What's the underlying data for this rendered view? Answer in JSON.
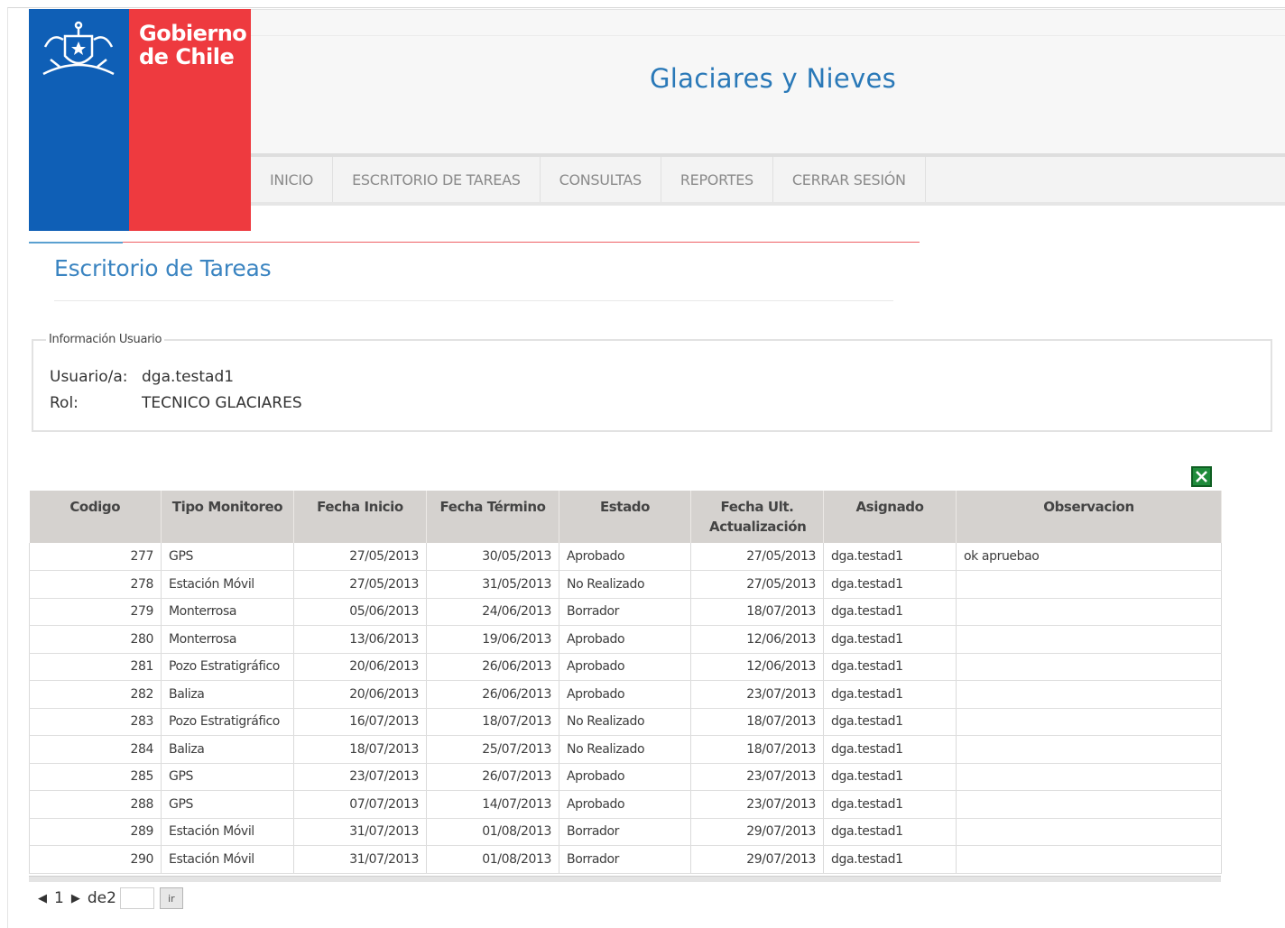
{
  "logo": {
    "line1": "Gobierno",
    "line2": "de Chile"
  },
  "header": {
    "title": "Glaciares y Nieves"
  },
  "nav": [
    "INICIO",
    "ESCRITORIO DE TAREAS",
    "CONSULTAS",
    "REPORTES",
    "CERRAR SESIÓN"
  ],
  "page": {
    "title": "Escritorio de Tareas"
  },
  "user_info": {
    "legend": "Información Usuario",
    "user_label": "Usuario/a:",
    "user_value": "dga.testad1",
    "role_label": "Rol:",
    "role_value": "TECNICO GLACIARES"
  },
  "table": {
    "headers": [
      "Codigo",
      "Tipo Monitoreo",
      "Fecha Inicio",
      "Fecha Término",
      "Estado",
      "Fecha Ult. Actualización",
      "Asignado",
      "Observacion"
    ],
    "rows": [
      [
        "277",
        "GPS",
        "27/05/2013",
        "30/05/2013",
        "Aprobado",
        "27/05/2013",
        "dga.testad1",
        "ok apruebao"
      ],
      [
        "278",
        "Estación Móvil",
        "27/05/2013",
        "31/05/2013",
        "No Realizado",
        "27/05/2013",
        "dga.testad1",
        ""
      ],
      [
        "279",
        "Monterrosa",
        "05/06/2013",
        "24/06/2013",
        "Borrador",
        "18/07/2013",
        "dga.testad1",
        ""
      ],
      [
        "280",
        "Monterrosa",
        "13/06/2013",
        "19/06/2013",
        "Aprobado",
        "12/06/2013",
        "dga.testad1",
        ""
      ],
      [
        "281",
        "Pozo Estratigráfico",
        "20/06/2013",
        "26/06/2013",
        "Aprobado",
        "12/06/2013",
        "dga.testad1",
        ""
      ],
      [
        "282",
        "Baliza",
        "20/06/2013",
        "26/06/2013",
        "Aprobado",
        "23/07/2013",
        "dga.testad1",
        ""
      ],
      [
        "283",
        "Pozo Estratigráfico",
        "16/07/2013",
        "18/07/2013",
        "No Realizado",
        "18/07/2013",
        "dga.testad1",
        ""
      ],
      [
        "284",
        "Baliza",
        "18/07/2013",
        "25/07/2013",
        "No Realizado",
        "18/07/2013",
        "dga.testad1",
        ""
      ],
      [
        "285",
        "GPS",
        "23/07/2013",
        "26/07/2013",
        "Aprobado",
        "23/07/2013",
        "dga.testad1",
        ""
      ],
      [
        "288",
        "GPS",
        "07/07/2013",
        "14/07/2013",
        "Aprobado",
        "23/07/2013",
        "dga.testad1",
        ""
      ],
      [
        "289",
        "Estación Móvil",
        "31/07/2013",
        "01/08/2013",
        "Borrador",
        "29/07/2013",
        "dga.testad1",
        ""
      ],
      [
        "290",
        "Estación Móvil",
        "31/07/2013",
        "01/08/2013",
        "Borrador",
        "29/07/2013",
        "dga.testad1",
        ""
      ]
    ]
  },
  "pager": {
    "current": "1",
    "of_label": "de",
    "total": "2",
    "go_label": "ir"
  },
  "colors": {
    "blue": "#0f5fb6",
    "red": "#ee3a3f",
    "title": "#2a79b8"
  },
  "icons": {
    "export": "excel-icon",
    "shield": "shield-icon"
  }
}
